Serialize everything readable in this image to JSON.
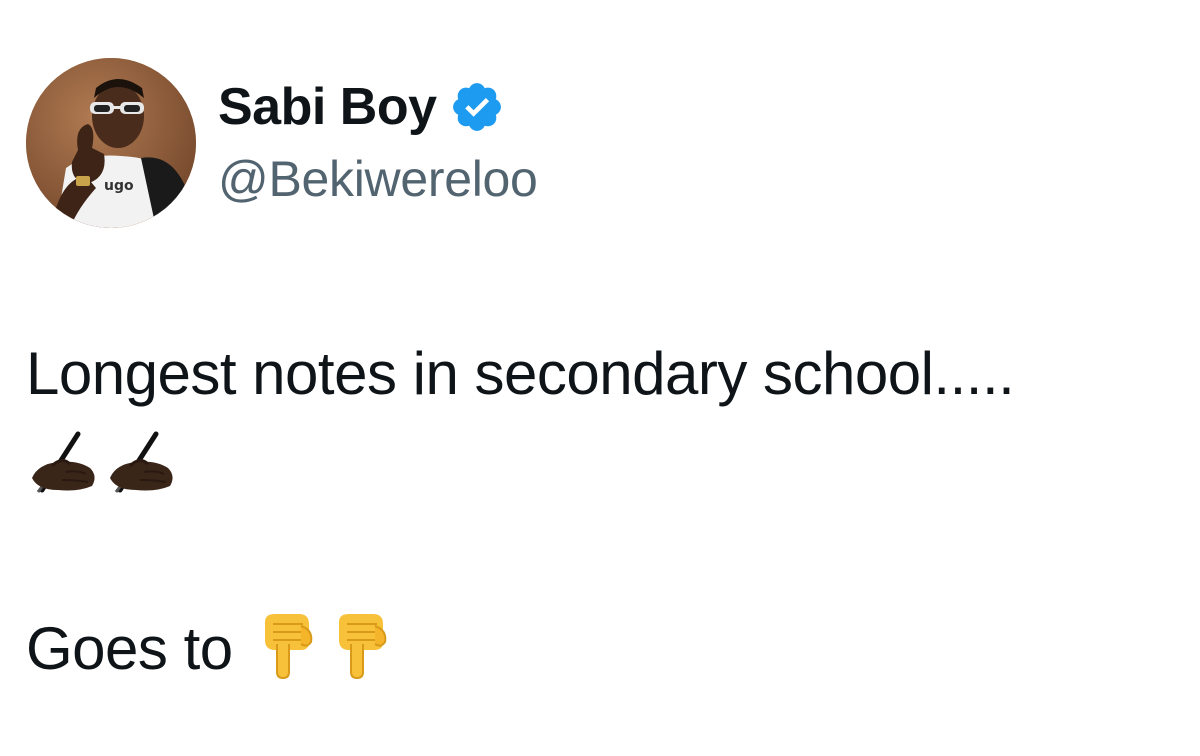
{
  "tweet": {
    "author": {
      "display_name": "Sabi Boy",
      "handle": "@Bekiwereloo",
      "verified": true,
      "verified_icon": "verified-badge-icon",
      "avatar_icon": "avatar-photo"
    },
    "text_line1": "Longest notes in secondary school.....",
    "emoji_line": [
      "writing-hand-icon",
      "writing-hand-icon"
    ],
    "text_line2": "Goes to",
    "emoji_after_line2": [
      "backhand-index-pointing-down-icon",
      "backhand-index-pointing-down-icon"
    ]
  },
  "colors": {
    "text": "#0f1419",
    "handle": "#536471",
    "verified": "#1d9bf0",
    "background": "#ffffff"
  }
}
